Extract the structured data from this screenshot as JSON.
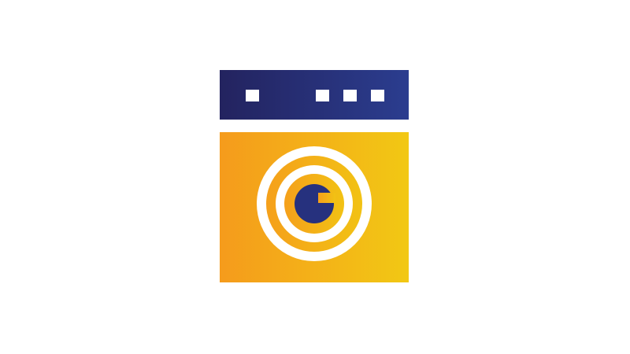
{
  "logo": {
    "icon": "washing-machine-icon",
    "colors": {
      "panel_dark": "#23235f",
      "panel_light": "#2b3d8f",
      "body_left": "#f59b1c",
      "body_right": "#f2c814",
      "ring": "#ffffff",
      "drum_core": "#26317e",
      "background": "#ffffff"
    }
  }
}
